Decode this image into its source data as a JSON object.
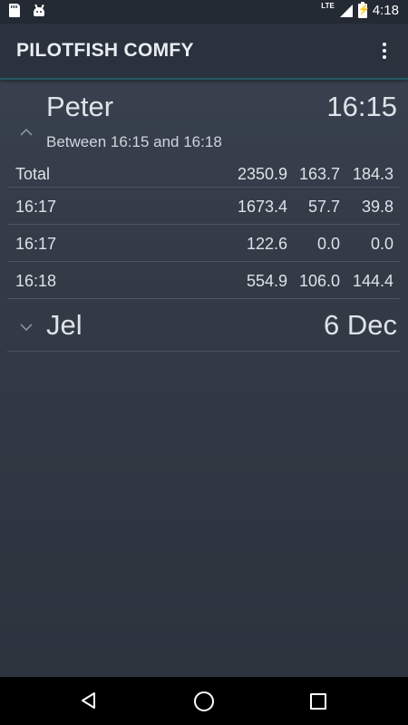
{
  "status_bar": {
    "network": "LTE",
    "time": "4:18"
  },
  "app_bar": {
    "title": "PILOTFISH COMFY",
    "overflow_icon": "more-vert-icon"
  },
  "groups": [
    {
      "name": "Peter",
      "time": "16:15",
      "expanded": true,
      "subtitle": "Between 16:15 and 16:18",
      "rows": [
        {
          "label": "Total",
          "v1": "2350.9",
          "v2": "163.7",
          "v3": "184.3"
        },
        {
          "label": "16:17",
          "v1": "1673.4",
          "v2": "57.7",
          "v3": "39.8"
        },
        {
          "label": "16:17",
          "v1": "122.6",
          "v2": "0.0",
          "v3": "0.0"
        },
        {
          "label": "16:18",
          "v1": "554.9",
          "v2": "106.0",
          "v3": "144.4"
        }
      ]
    },
    {
      "name": "Jel",
      "time": "6 Dec",
      "expanded": false
    }
  ],
  "nav_bar": {
    "back_icon": "back-triangle-icon",
    "home_icon": "home-circle-icon",
    "recents_icon": "recents-square-icon"
  }
}
